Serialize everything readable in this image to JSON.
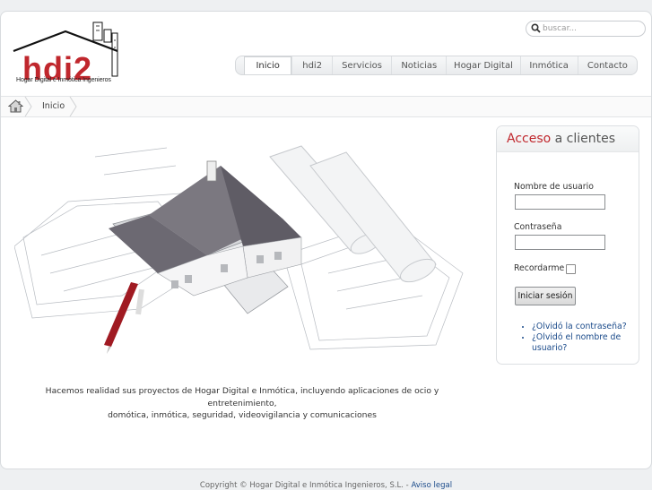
{
  "brand": {
    "logo_text": "hdi2",
    "tagline": "Hogar Digital e Inmótica Ingenieros",
    "accent_color": "#c0272d"
  },
  "search": {
    "placeholder": "buscar...",
    "icon": "search-icon"
  },
  "nav": {
    "items": [
      {
        "label": "Inicio",
        "active": true
      },
      {
        "label": "hdi2"
      },
      {
        "label": "Servicios"
      },
      {
        "label": "Noticias"
      },
      {
        "label": "Hogar Digital"
      },
      {
        "label": "Inmótica"
      },
      {
        "label": "Contacto"
      }
    ]
  },
  "breadcrumb": {
    "home_icon": "home-icon",
    "current": "Inicio"
  },
  "hero": {
    "image_subject": "house-model-on-blueprints",
    "caption_line1": "Hacemos realidad sus proyectos de Hogar Digital e Inmótica, incluyendo aplicaciones de ocio y entretenimiento,",
    "caption_line2": "domótica, inmótica, seguridad, videovigilancia y comunicaciones"
  },
  "login": {
    "title_highlight": "Acceso",
    "title_rest": " a clientes",
    "username_label": "Nombre de usuario",
    "username_value": "",
    "password_label": "Contraseña",
    "password_value": "",
    "remember_label": "Recordarme",
    "remember_checked": false,
    "submit_label": "Iniciar sesión",
    "links": [
      "¿Olvidó la contraseña?",
      "¿Olvidó el nombre de usuario?"
    ]
  },
  "footer": {
    "copyright": "Copyright © Hogar Digital e Inmótica Ingenieros, S.L. - ",
    "legal_link": "Aviso legal"
  }
}
